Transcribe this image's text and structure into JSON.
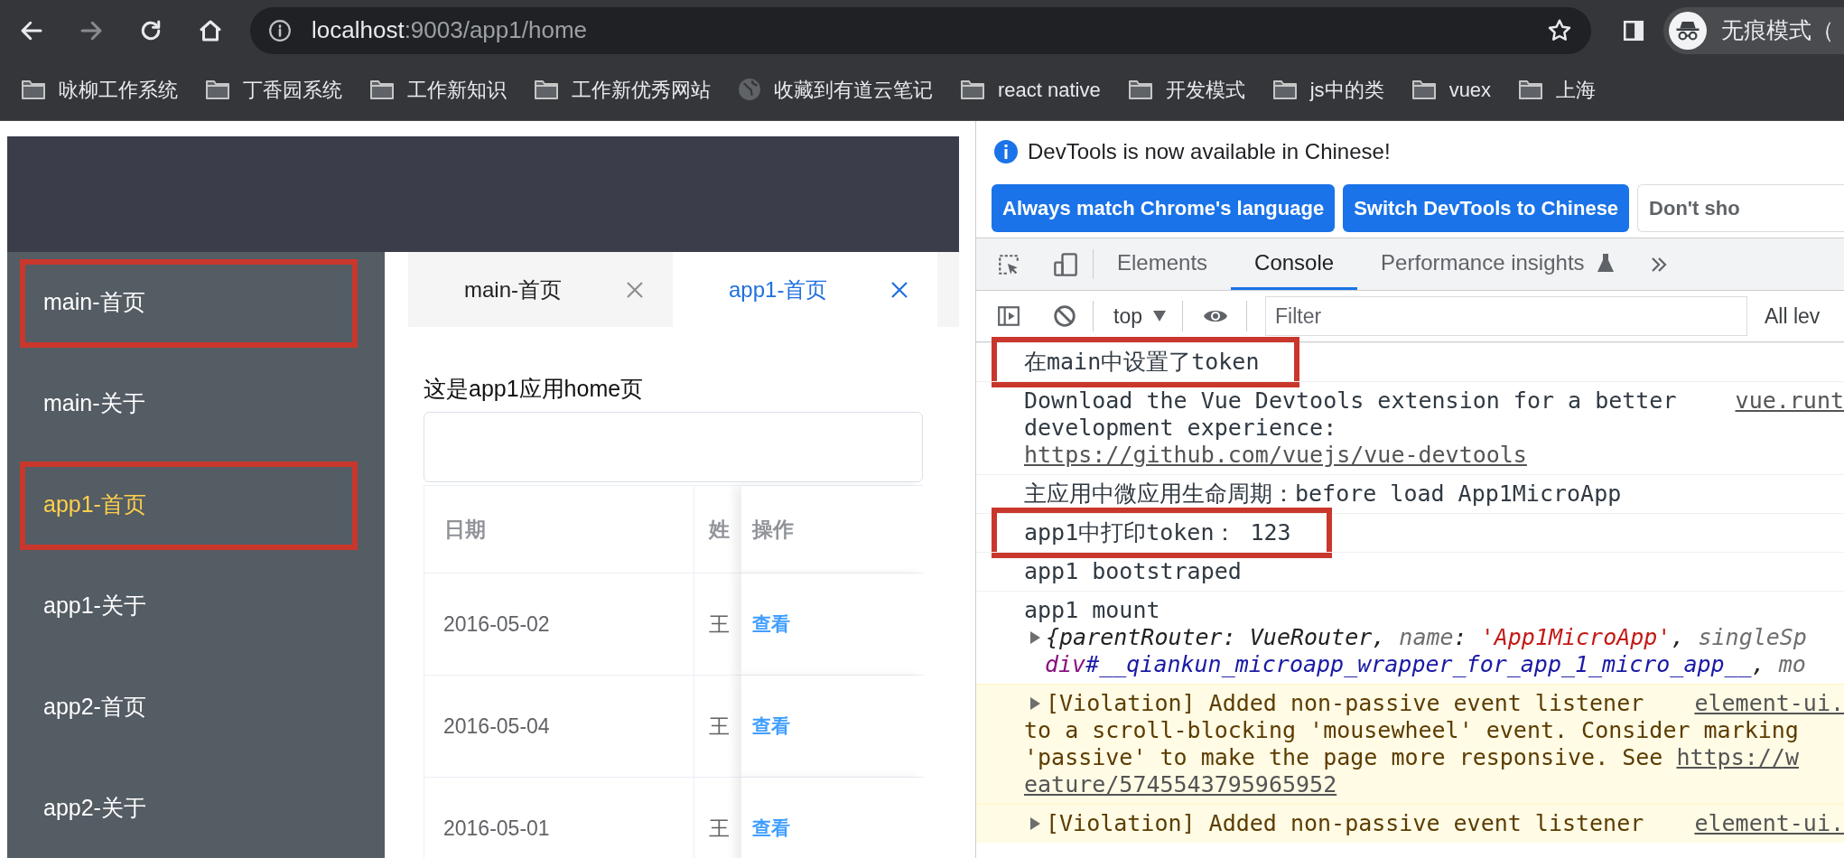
{
  "browser": {
    "nav": [
      {
        "kind": "back",
        "disabled": false
      },
      {
        "kind": "forward",
        "disabled": true
      },
      {
        "kind": "reload",
        "disabled": false
      },
      {
        "kind": "home",
        "disabled": false
      }
    ],
    "address": {
      "host": "localhost",
      "path": ":9003/app1/home"
    },
    "profile": {
      "label": "无痕模式（"
    },
    "bookmarks": [
      {
        "label": "咏柳工作系统",
        "kind": "folder"
      },
      {
        "label": "丁香园系统",
        "kind": "folder"
      },
      {
        "label": "工作新知识",
        "kind": "folder"
      },
      {
        "label": "工作新优秀网站",
        "kind": "folder"
      },
      {
        "label": "收藏到有道云笔记",
        "kind": "site"
      },
      {
        "label": "react native",
        "kind": "folder"
      },
      {
        "label": "开发模式",
        "kind": "folder"
      },
      {
        "label": "js中的类",
        "kind": "folder"
      },
      {
        "label": "vuex",
        "kind": "folder"
      },
      {
        "label": "上海",
        "kind": "folder"
      }
    ]
  },
  "app": {
    "sidebar": {
      "items": [
        {
          "label": "main-首页",
          "selected": false,
          "annotated": true
        },
        {
          "label": "main-关于",
          "selected": false,
          "annotated": false
        },
        {
          "label": "app1-首页",
          "selected": true,
          "annotated": true
        },
        {
          "label": "app1-关于",
          "selected": false,
          "annotated": false
        },
        {
          "label": "app2-首页",
          "selected": false,
          "annotated": false
        },
        {
          "label": "app2-关于",
          "selected": false,
          "annotated": false
        }
      ]
    },
    "tabs": [
      {
        "label": "main-首页",
        "selected": false
      },
      {
        "label": "app1-首页",
        "selected": true
      }
    ],
    "heading": "这是app1应用home页",
    "table": {
      "columns": [
        "日期",
        "姓",
        "操作"
      ],
      "rows": [
        {
          "date": "2016-05-02",
          "name": "王",
          "action": "查看"
        },
        {
          "date": "2016-05-04",
          "name": "王",
          "action": "查看"
        },
        {
          "date": "2016-05-01",
          "name": "王",
          "action": "查看"
        }
      ]
    }
  },
  "devtools": {
    "banner": {
      "message": "DevTools is now available in Chinese!",
      "buttons": [
        {
          "label": "Always match Chrome's language",
          "kind": "primary"
        },
        {
          "label": "Switch DevTools to Chinese",
          "kind": "primary"
        },
        {
          "label": "Don't sho",
          "kind": "secondary"
        }
      ]
    },
    "tabs": [
      {
        "label": "Elements",
        "selected": false,
        "kind": "plain"
      },
      {
        "label": "Console",
        "selected": true,
        "kind": "plain"
      },
      {
        "label": "Performance insights",
        "selected": false,
        "kind": "experiment"
      }
    ],
    "toolbar": {
      "context": "top",
      "filter_placeholder": "Filter",
      "levels": "All lev"
    },
    "messages": [
      {
        "kind": "log",
        "annotated": true,
        "lines": [
          {
            "kind": "plain",
            "segments": [
              {
                "text": "在main中设置了token",
                "kind": "text"
              }
            ]
          }
        ]
      },
      {
        "kind": "log",
        "annotated": false,
        "source": "vue.runt",
        "lines": [
          {
            "kind": "plain",
            "segments": [
              {
                "text": "Download the Vue Devtools extension for a better",
                "kind": "text"
              }
            ]
          },
          {
            "kind": "plain",
            "segments": [
              {
                "text": "development experience:",
                "kind": "text"
              }
            ]
          },
          {
            "kind": "plain",
            "segments": [
              {
                "text": "https://github.com/vuejs/vue-devtools",
                "kind": "link"
              }
            ]
          }
        ]
      },
      {
        "kind": "log",
        "annotated": false,
        "lines": [
          {
            "kind": "plain",
            "segments": [
              {
                "text": "主应用中微应用生命周期：before load App1MicroApp",
                "kind": "text"
              }
            ]
          }
        ]
      },
      {
        "kind": "log",
        "annotated": true,
        "lines": [
          {
            "kind": "plain",
            "segments": [
              {
                "text": "app1中打印token： 123",
                "kind": "text"
              }
            ]
          }
        ]
      },
      {
        "kind": "log",
        "annotated": false,
        "lines": [
          {
            "kind": "plain",
            "segments": [
              {
                "text": "app1 bootstraped",
                "kind": "text"
              }
            ]
          }
        ]
      },
      {
        "kind": "log",
        "annotated": false,
        "lines": [
          {
            "kind": "plain",
            "segments": [
              {
                "text": "app1 mount",
                "kind": "text"
              }
            ]
          },
          {
            "kind": "expander",
            "segments": [
              {
                "text": "{parentRouter",
                "kind": "key"
              },
              {
                "text": ": VueRouter, ",
                "kind": "value"
              },
              {
                "text": "name",
                "kind": "dim"
              },
              {
                "text": ": ",
                "kind": "value"
              },
              {
                "text": "'App1MicroApp'",
                "kind": "string"
              },
              {
                "text": ", ",
                "kind": "value"
              },
              {
                "text": "singleSp",
                "kind": "dim"
              }
            ]
          },
          {
            "kind": "indented",
            "segments": [
              {
                "text": "div",
                "kind": "tag"
              },
              {
                "text": "#__qiankun_microapp_wrapper_for_app_1_micro_app__",
                "kind": "id"
              },
              {
                "text": ", ",
                "kind": "value"
              },
              {
                "text": "mo",
                "kind": "dim"
              }
            ]
          }
        ]
      },
      {
        "kind": "warning",
        "annotated": false,
        "source": "element-ui.",
        "lines": [
          {
            "kind": "expander",
            "segments": [
              {
                "text": "[Violation] Added non-passive event listener",
                "kind": "text"
              }
            ]
          },
          {
            "kind": "plain",
            "segments": [
              {
                "text": "to a scroll-blocking 'mousewheel' event. Consider marking",
                "kind": "text"
              }
            ]
          },
          {
            "kind": "plain",
            "segments": [
              {
                "text": "'passive' to make the page more responsive. See ",
                "kind": "text"
              },
              {
                "text": "https://w",
                "kind": "link"
              }
            ]
          },
          {
            "kind": "plain",
            "segments": [
              {
                "text": "eature/5745543795965952",
                "kind": "link"
              }
            ]
          }
        ]
      },
      {
        "kind": "warning",
        "annotated": false,
        "source": "element-ui.",
        "lines": [
          {
            "kind": "expander",
            "segments": [
              {
                "text": "[Violation] Added non-passive event listener",
                "kind": "text"
              }
            ]
          }
        ]
      }
    ]
  }
}
